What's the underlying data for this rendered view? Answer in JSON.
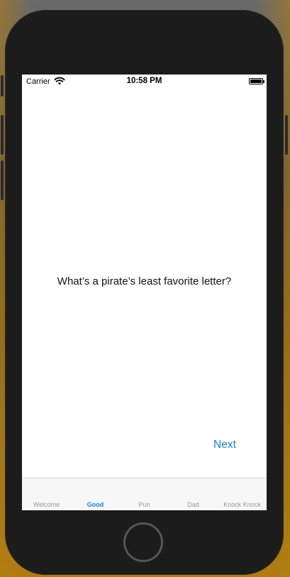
{
  "status_bar": {
    "carrier": "Carrier",
    "time": "10:58 PM",
    "wifi_icon": "wifi-icon",
    "battery_icon": "battery-icon"
  },
  "content": {
    "question": "What’s a pirate’s least favorite letter?",
    "next_label": "Next"
  },
  "tab_bar": {
    "tabs": [
      {
        "label": "Welcome",
        "active": false
      },
      {
        "label": "Good",
        "active": true
      },
      {
        "label": "Pun",
        "active": false
      },
      {
        "label": "Dad",
        "active": false
      },
      {
        "label": "Knock Knock",
        "active": false
      }
    ]
  },
  "colors": {
    "accent": "#1a7ee6",
    "inactive_tab": "#9a9a9a",
    "device_frame": "#1c1c1c"
  }
}
